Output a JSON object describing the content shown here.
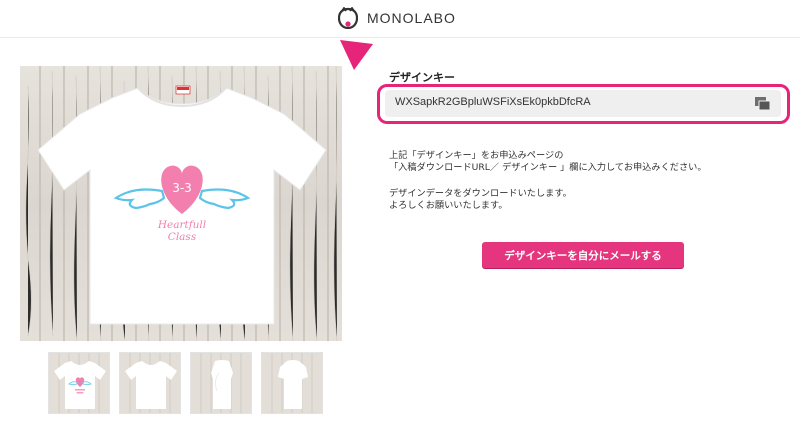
{
  "header": {
    "brand": "MONOLABO",
    "logo_icon": "monolabo-logo-icon"
  },
  "product": {
    "print_line1": "3-3",
    "print_line2": "Heartfull",
    "print_line3": "Class",
    "thumbnails": [
      "front-with-print",
      "front-plain",
      "side-view",
      "back-view"
    ]
  },
  "design_key": {
    "label": "デザインキー",
    "value": "WXSapkR2GBpluWSFiXsEk0pkbDfcRA",
    "copy_icon": "copy-icon"
  },
  "description": {
    "line1": "上記「デザインキー」をお申込みページの",
    "line2": "「入稿ダウンロードURL／ デザインキー 」欄に入力してお申込みください。",
    "line3": "デザインデータをダウンロードいたします。",
    "line4": "よろしくお願いいたします。"
  },
  "actions": {
    "mail_button_label": "デザインキーを自分にメールする"
  },
  "colors": {
    "accent": "#e6247a",
    "button": "#e5357e",
    "heart": "#f27fae",
    "wings": "#5cc4e8"
  }
}
